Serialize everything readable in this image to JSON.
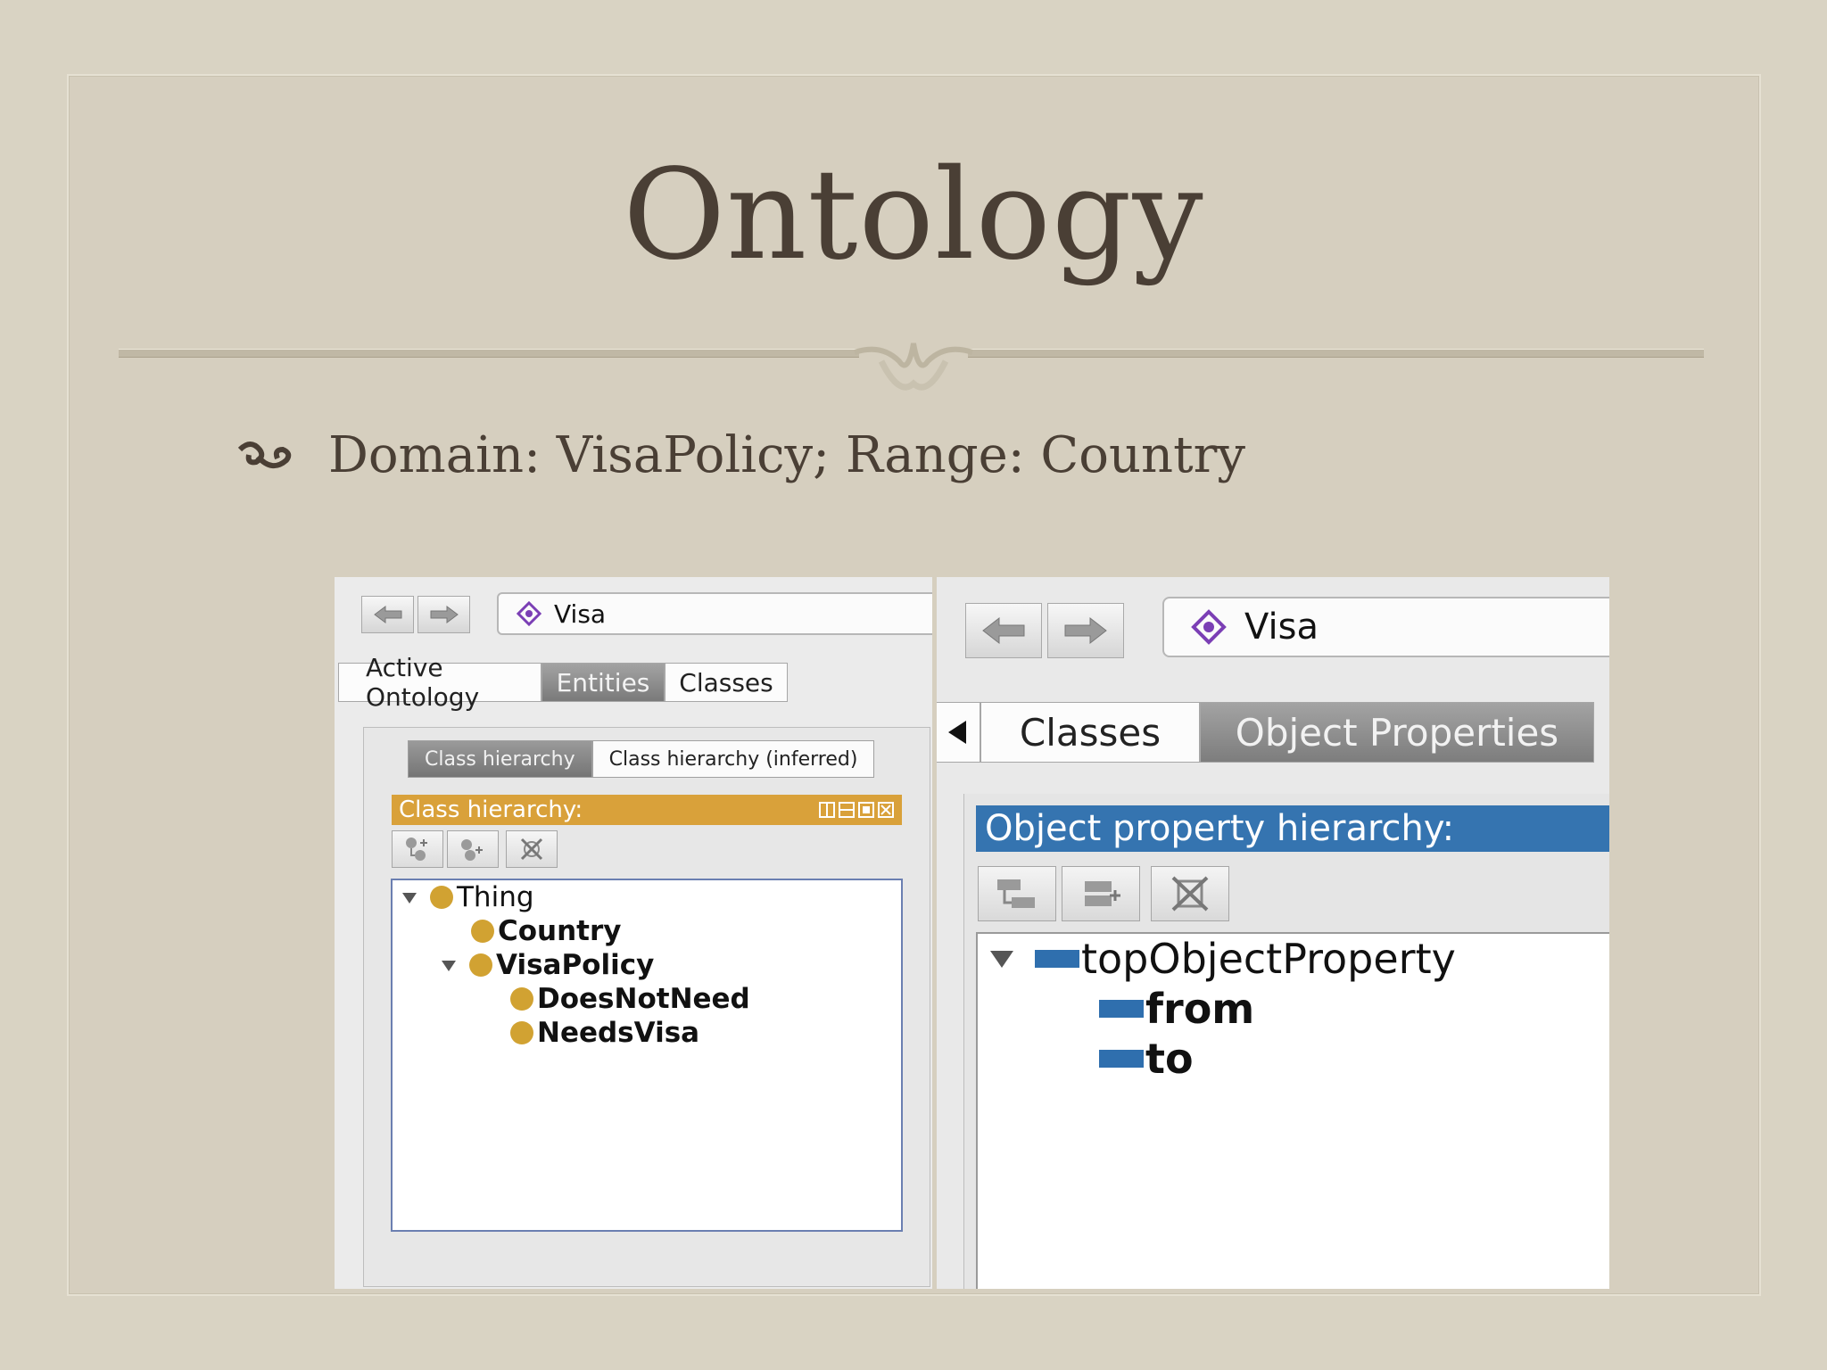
{
  "slide": {
    "title": "Ontology",
    "bullet": "Domain: VisaPolicy; Range: Country"
  },
  "left_screenshot": {
    "entity_field": "Visa",
    "tabs": [
      "Active Ontology",
      "Entities",
      "Classes"
    ],
    "active_tab": "Entities",
    "subtabs": [
      "Class hierarchy",
      "Class hierarchy (inferred)"
    ],
    "active_subtab": "Class hierarchy",
    "panel_title": "Class hierarchy:",
    "tree": [
      {
        "label": "Thing",
        "depth": 0,
        "expanded": true
      },
      {
        "label": "Country",
        "depth": 1,
        "expanded": false
      },
      {
        "label": "VisaPolicy",
        "depth": 1,
        "expanded": true
      },
      {
        "label": "DoesNotNeed",
        "depth": 2,
        "expanded": false
      },
      {
        "label": "NeedsVisa",
        "depth": 2,
        "expanded": false
      }
    ]
  },
  "right_screenshot": {
    "entity_field": "Visa",
    "tabs": [
      "Classes",
      "Object Properties"
    ],
    "active_tab": "Object Properties",
    "panel_title": "Object property hierarchy:",
    "tree": [
      {
        "label": "topObjectProperty",
        "depth": 0,
        "expanded": true
      },
      {
        "label": "from",
        "depth": 1,
        "expanded": false
      },
      {
        "label": "to",
        "depth": 1,
        "expanded": false
      }
    ]
  },
  "colors": {
    "slide_background": "#d9d3c3",
    "title_text": "#4a3f35",
    "class_header": "#d9a13a",
    "class_dot": "#d1a232",
    "property_header": "#3574b0",
    "property_bar": "#2f6fae",
    "active_tab": "#7a7a7a",
    "entity_icon": "#7b3fb5"
  },
  "icons": {
    "bullet": "fleuron-icon",
    "back": "back-arrow-icon",
    "forward": "forward-arrow-icon",
    "entity": "entity-diamond-icon",
    "add_subclass": "add-subclass-icon",
    "add_sibling": "add-sibling-icon",
    "delete": "delete-icon",
    "collapse": "collapse-triangle-icon",
    "expand_left": "left-triangle-icon"
  }
}
